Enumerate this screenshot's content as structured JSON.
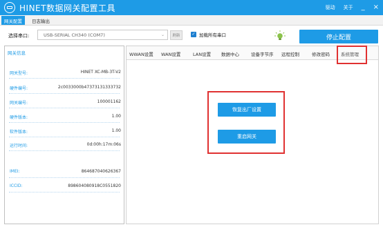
{
  "app": {
    "title": "HINET数据网关配置工具",
    "driver_link": "驱动",
    "about_link": "关于",
    "minimize": "_",
    "close": "×"
  },
  "menu": {
    "tabs": [
      {
        "label": "网关配置",
        "active": true
      },
      {
        "label": "日志输出",
        "active": false
      }
    ]
  },
  "toolbar": {
    "port_label": "选择串口:",
    "port_value": "USB-SERIAL CH340 (COM7)",
    "refresh_label": "刷新",
    "load_all_label": "加载所有串口",
    "load_all_checked": true,
    "stop_label": "停止配置"
  },
  "info": {
    "section_title": "网关信息",
    "rows": [
      {
        "key": "网关型号:",
        "value": "HINET XC-MB-3T-V2"
      },
      {
        "key": "硬件编号:",
        "value": "2c0033000b47373131333732"
      },
      {
        "key": "网关编号:",
        "value": "100001162"
      },
      {
        "key": "硬件版本:",
        "value": "1.00"
      },
      {
        "key": "软件版本:",
        "value": "1.00"
      },
      {
        "key": "运行时间:",
        "value": "0d:00h:17m:06s"
      },
      {
        "key": "IMEI:",
        "value": "864687040626367"
      },
      {
        "key": "ICCID:",
        "value": "898604080918C0551820"
      }
    ]
  },
  "tabs": [
    {
      "label": "WWAN设置"
    },
    {
      "label": "WAN设置"
    },
    {
      "label": "LAN设置"
    },
    {
      "label": "数据中心"
    },
    {
      "label": "设备字节序"
    },
    {
      "label": "远程控制"
    },
    {
      "label": "修改密码"
    },
    {
      "label": "系统管理",
      "active": true
    }
  ],
  "system": {
    "reset_label": "恢复出厂设置",
    "reboot_label": "重启网关"
  },
  "colors": {
    "accent": "#1e9be6",
    "highlight": "#e03030"
  }
}
